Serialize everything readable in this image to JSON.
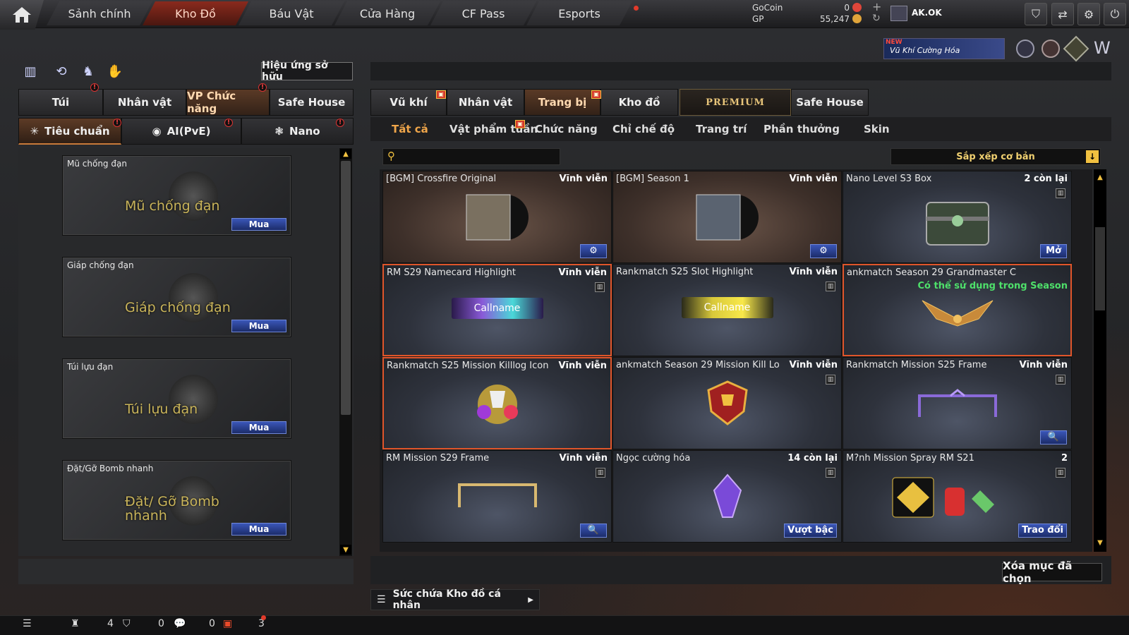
{
  "nav": {
    "tabs": [
      {
        "label": "Sảnh chính"
      },
      {
        "label": "Kho Đồ"
      },
      {
        "label": "Báu Vật"
      },
      {
        "label": "Cửa Hàng"
      },
      {
        "label": "CF Pass"
      },
      {
        "label": "Esports"
      }
    ],
    "active": "Kho Đồ",
    "currency": {
      "gocoin_label": "GoCoin",
      "gocoin_value": "0",
      "gp_label": "GP",
      "gp_value": "55,247"
    },
    "username": "AK.OK"
  },
  "promo": {
    "badge": "NEW",
    "text": "Vũ Khí Cường Hóa"
  },
  "left": {
    "effect_button": "Hiệu ứng sở hữu",
    "tabs": [
      "Túi",
      "Nhân vật",
      "VP Chức năng",
      "Safe House"
    ],
    "active_tab": "VP Chức năng",
    "subtabs": [
      "Tiêu chuẩn",
      "AI(PvE)",
      "Nano"
    ],
    "items": [
      {
        "name": "Mũ chống đạn",
        "big": "Mũ chống đạn",
        "buy": "Mua"
      },
      {
        "name": "Giáp chống đạn",
        "big": "Giáp chống đạn",
        "buy": "Mua"
      },
      {
        "name": "Túi lựu đạn",
        "big": "Túi lựu đạn",
        "buy": "Mua"
      },
      {
        "name": "Đặt/Gỡ Bomb nhanh",
        "big": "Đặt/ Gỡ Bomb nhanh",
        "buy": "Mua"
      }
    ]
  },
  "right": {
    "tabs": [
      "Vũ khí",
      "Nhân vật",
      "Trang bị",
      "Kho đồ",
      "PREMIUM",
      "Safe House"
    ],
    "active_tab": "Trang bị",
    "subtabs": [
      "Tất cả",
      "Vật phẩm tuần",
      "Chức năng",
      "Chỉ chế độ",
      "Trang trí",
      "Phần thưởng",
      "Skin"
    ],
    "active_sub": "Tất cả",
    "sort": "Sắp xếp cơ bản",
    "cards": [
      {
        "name": "[BGM] Crossfire Original",
        "dur": "Vĩnh viễn",
        "btn": "⚙"
      },
      {
        "name": "[BGM] Season 1",
        "dur": "Vĩnh viễn",
        "btn": "⚙"
      },
      {
        "name": "Nano Level S3 Box",
        "dur": "2 còn lại",
        "btn": "Mở"
      },
      {
        "name": "RM S29 Namecard Highlight",
        "dur": "Vĩnh viễn",
        "btn": "",
        "art": "Callname"
      },
      {
        "name": "Rankmatch S25 Slot Highlight",
        "dur": "Vĩnh viễn",
        "btn": "",
        "art": "Callname"
      },
      {
        "name": "ankmatch Season 29 Grandmaster C",
        "dur": "",
        "note": "Có thể sử dụng trong Season",
        "btn": ""
      },
      {
        "name": "Rankmatch S25 Mission Killlog Icon",
        "dur": "Vĩnh viễn",
        "btn": ""
      },
      {
        "name": "ankmatch Season 29 Mission Kill Lo",
        "dur": "Vĩnh viễn",
        "btn": ""
      },
      {
        "name": "Rankmatch Mission S25 Frame",
        "dur": "Vĩnh viễn",
        "btn": "🔍"
      },
      {
        "name": "RM Mission S29 Frame",
        "dur": "Vĩnh viễn",
        "btn": "🔍"
      },
      {
        "name": "Ngọc cường hóa",
        "dur": "14 còn lại",
        "btn": "Vượt bậc"
      },
      {
        "name": "M?nh Mission Spray RM S21",
        "dur": "2",
        "btn": "Trao đổi"
      }
    ],
    "delete_button": "Xóa mục đã chọn",
    "capacity": "Sức chứa Kho đồ cá nhân"
  },
  "bottom": {
    "count1": "4",
    "count2": "0",
    "count3": "0",
    "count4": "3"
  },
  "colors": {
    "accent": "#f0a64a",
    "selected_border": "#e0552a",
    "button_blue": "#3a56b8",
    "alert_red": "#e23a2a"
  }
}
